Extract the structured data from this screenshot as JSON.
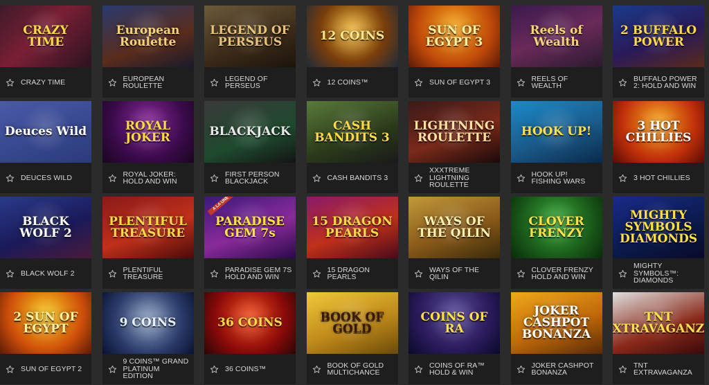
{
  "games": [
    {
      "label": "CRAZY TIME",
      "art": "CRAZY TIME",
      "bg": "linear-gradient(135deg,#3d1b2a,#7a1f35 45%,#2b1320)",
      "fg": "#ffd84a"
    },
    {
      "label": "EUROPEAN ROULETTE",
      "art": "European Roulette",
      "bg": "linear-gradient(160deg,#2a3a6e,#5a2c1c 60%,#1a1a2a)",
      "fg": "#f6d27a"
    },
    {
      "label": "LEGEND OF PERSEUS",
      "art": "LEGEND OF PERSEUS",
      "bg": "linear-gradient(160deg,#6b5a3a,#3b2a18 60%,#1c140c)",
      "fg": "#e6c27a"
    },
    {
      "label": "12 COINS™",
      "art": "12 COINS",
      "bg": "radial-gradient(circle at 50% 40%,#f0b93a,#7a3e0c 55%,#1e2a3a)",
      "fg": "#ffe58a"
    },
    {
      "label": "SUN OF EGYPT 3",
      "art": "SUN OF EGYPT 3",
      "bg": "radial-gradient(circle at 50% 35%,#f6a81e,#c04a0a 60%,#5a1a06)",
      "fg": "#fff0a0"
    },
    {
      "label": "REELS OF WEALTH",
      "art": "Reels of Wealth",
      "bg": "linear-gradient(160deg,#3a1a4e,#6a2a5a 50%,#2a1a2e)",
      "fg": "#f6d27a"
    },
    {
      "label": "BUFFALO POWER 2: HOLD AND WIN",
      "art": "2 BUFFALO POWER",
      "bg": "linear-gradient(160deg,#1a3a8a,#2a1a5a 55%,#5a2a1a)",
      "fg": "#ffd84a"
    },
    {
      "label": "DEUCES WILD",
      "art": "Deuces Wild",
      "bg": "linear-gradient(160deg,#4a5aa8,#2a3a7a)",
      "fg": "#ffffff"
    },
    {
      "label": "ROYAL JOKER: HOLD AND WIN",
      "art": "ROYAL JOKER",
      "bg": "radial-gradient(circle at 50% 35%,#8a2a9a,#3a0a4a 60%,#1a0620)",
      "fg": "#ffd84a"
    },
    {
      "label": "FIRST PERSON BLACKJACK",
      "art": "BLACKJACK",
      "bg": "linear-gradient(160deg,#3a3a3a,#1e4a2e 60%,#141414)",
      "fg": "#e8e8e8"
    },
    {
      "label": "CASH BANDITS 3",
      "art": "CASH BANDITS 3",
      "bg": "linear-gradient(160deg,#5a7a3a,#2a3a1a 60%,#1a1a1a)",
      "fg": "#ffd84a"
    },
    {
      "label": "XXXTREME LIGHTNING ROULETTE",
      "art": "LIGHTNING ROULETTE",
      "bg": "linear-gradient(160deg,#3a1a1a,#7a2a1a 55%,#1a0a0a)",
      "fg": "#ffe0a0"
    },
    {
      "label": "HOOK UP! FISHING WARS",
      "art": "HOOK UP!",
      "bg": "linear-gradient(160deg,#1a8aca,#1a5a8a 55%,#0a2a4a)",
      "fg": "#ffe04a"
    },
    {
      "label": "3 HOT CHILLIES",
      "art": "3 HOT CHILLIES",
      "bg": "radial-gradient(circle at 50% 35%,#f6a81e,#c0300a 60%,#5a0a06)",
      "fg": "#ffffff"
    },
    {
      "label": "BLACK WOLF 2",
      "art": "BLACK WOLF 2",
      "bg": "linear-gradient(160deg,#2a3a8a,#1a1a5a 55%,#4a1a3a)",
      "fg": "#ffffff"
    },
    {
      "label": "PLENTIFUL TREASURE",
      "art": "PLENTIFUL TREASURE",
      "bg": "linear-gradient(160deg,#8a1a1a,#c0301a 55%,#4a0a0a)",
      "fg": "#ffd84a"
    },
    {
      "label": "PARADISE GEM 7S HOLD AND WIN",
      "art": "PARADISE GEM 7s",
      "bg": "linear-gradient(160deg,#3a1a7a,#8a2a9a 55%,#2a0a4a)",
      "fg": "#ffe04a"
    },
    {
      "label": "15 DRAGON PEARLS",
      "art": "15 DRAGON PEARLS",
      "bg": "linear-gradient(160deg,#8a1a6a,#c0301a 55%,#4a0a1a)",
      "fg": "#ffd84a"
    },
    {
      "label": "WAYS OF THE QILIN",
      "art": "WAYS OF THE QILIN",
      "bg": "linear-gradient(160deg,#c09a3a,#8a5a1a 55%,#3a2a0a)",
      "fg": "#fff0b0"
    },
    {
      "label": "CLOVER FRENZY HOLD AND WIN",
      "art": "CLOVER FRENZY",
      "bg": "radial-gradient(circle at 50% 40%,#3aaa3a,#1a5a1a 60%,#0a2a0a)",
      "fg": "#ffe04a"
    },
    {
      "label": "MIGHTY SYMBOLS™: DIAMONDS",
      "art": "MIGHTY SYMBOLS DIAMONDS",
      "bg": "linear-gradient(160deg,#1a2a8a,#0a1a4a 60%,#0a0a2a)",
      "fg": "#ffe04a"
    },
    {
      "label": "SUN OF EGYPT 2",
      "art": "2 SUN OF EGYPT",
      "bg": "radial-gradient(circle at 50% 35%,#f6c81e,#d0500a 60%,#5a1a06)",
      "fg": "#fff0a0"
    },
    {
      "label": "9 COINS™ GRAND PLATINUM EDITION",
      "art": "9 COINS",
      "bg": "radial-gradient(circle at 50% 45%,#8aa0c0,#2a3a6a 60%,#0a1230)",
      "fg": "#e8f0ff"
    },
    {
      "label": "36 COINS™",
      "art": "36 COINS",
      "bg": "radial-gradient(circle at 50% 40%,#f04a1a,#8a0a0a 60%,#2a0606)",
      "fg": "#ffd84a"
    },
    {
      "label": "BOOK OF GOLD MULTICHANCE",
      "art": "BOOK OF GOLD",
      "bg": "linear-gradient(160deg,#f0c83a,#c08a1a 55%,#6a4a0a)",
      "fg": "#3a1a06"
    },
    {
      "label": "COINS OF RA™ HOLD & WIN",
      "art": "COINS OF RA",
      "bg": "radial-gradient(circle at 50% 35%,#5a4a9a,#2a1a5a 60%,#0a0a2a)",
      "fg": "#ffe04a"
    },
    {
      "label": "JOKER CASHPOT BONANZA",
      "art": "JOKER CASHPOT BONANZA",
      "bg": "linear-gradient(160deg,#f0a81a,#c06a0a 55%,#5a2a06)",
      "fg": "#ffffff"
    },
    {
      "label": "TNT EXTRAVAGANZA",
      "art": "TNT EXTRAVAGANZA",
      "bg": "linear-gradient(160deg,#e0e0e0,#8a2a1a 60%,#3a0a0a)",
      "fg": "#ffe04a"
    }
  ],
  "badges": {
    "paradise_gem": "A LA UNE"
  },
  "colors": {
    "page_bg": "#2b2b2b",
    "caption_bg": "#1e1e1e",
    "caption_text": "#d9d9d9",
    "star_outline": "#bdbdbd"
  },
  "icons": {
    "favorite": "star-outline-icon"
  }
}
